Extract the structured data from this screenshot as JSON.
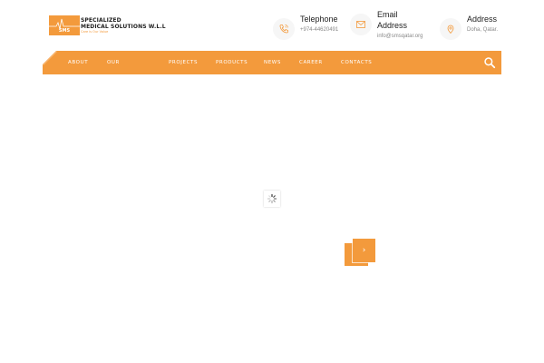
{
  "colors": {
    "accent": "#f39a3c",
    "text": "#222222",
    "muted": "#888888"
  },
  "logo": {
    "mark_text": "SMS",
    "line1": "SPECIALIZED",
    "line2": "MEDICAL SOLUTIONS W.L.L",
    "tagline": "Care is Our Value"
  },
  "contacts": {
    "telephone": {
      "label": "Telephone",
      "value": "+974-44620491",
      "icon": "phone-icon"
    },
    "email": {
      "label": "Email Address",
      "value": "info@smsqatar.org",
      "icon": "envelope-icon"
    },
    "address": {
      "label": "Address",
      "value": "Doha, Qatar.",
      "icon": "map-pin-icon"
    }
  },
  "nav": {
    "items": [
      {
        "label": "ABOUT"
      },
      {
        "label": "OUR"
      },
      {
        "label": "PROJECTS"
      },
      {
        "label": "PRODUCTS"
      },
      {
        "label": "NEWS"
      },
      {
        "label": "CAREER"
      },
      {
        "label": "CONTACTS"
      }
    ],
    "search_icon": "search-icon"
  },
  "slider": {
    "next_icon": "chevron-right-icon",
    "next_glyph": "›"
  },
  "loader_icon": "spinner-icon"
}
